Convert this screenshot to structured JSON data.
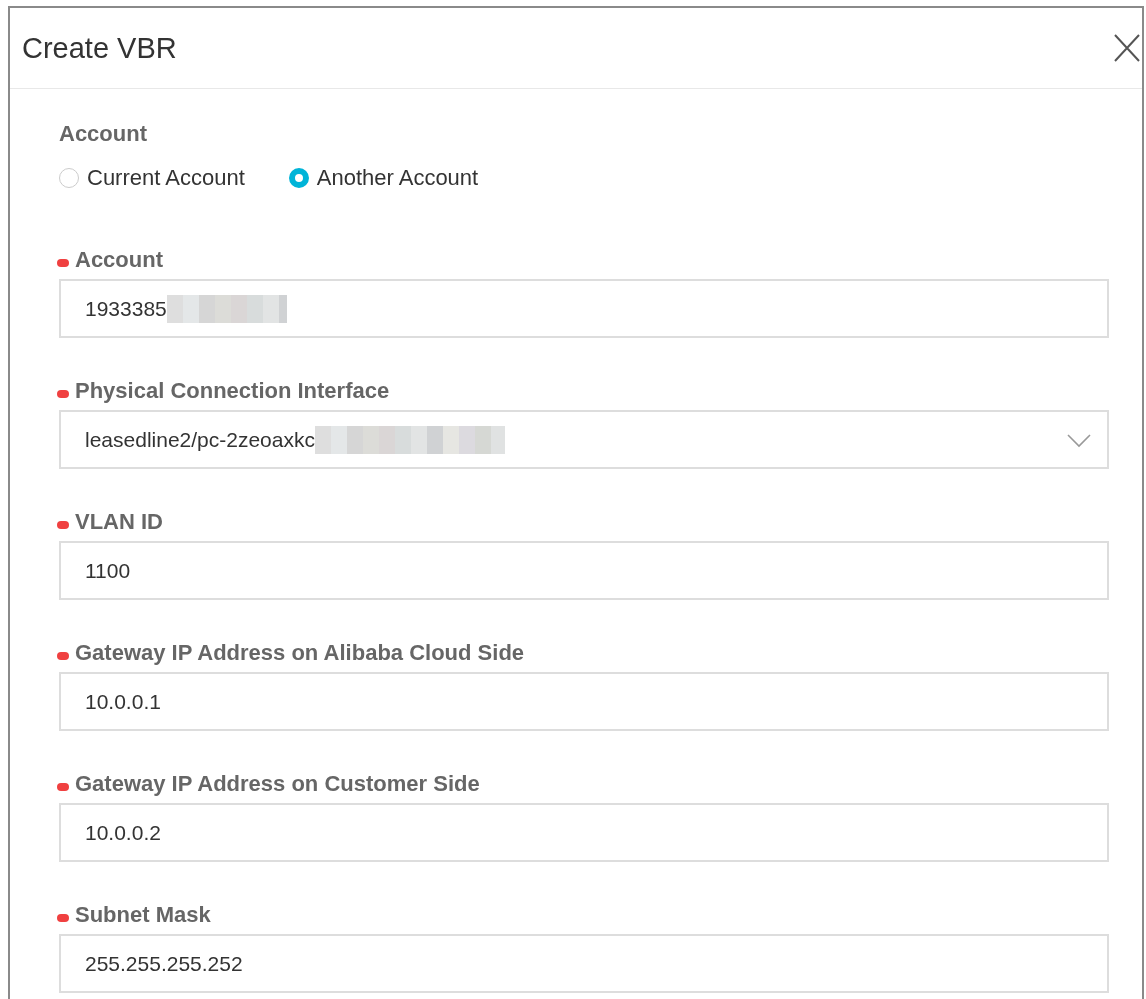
{
  "dialog": {
    "title": "Create VBR"
  },
  "account_type": {
    "label": "Account",
    "options": [
      {
        "label": "Current Account",
        "selected": false
      },
      {
        "label": "Another Account",
        "selected": true
      }
    ]
  },
  "fields": [
    {
      "label": "Account",
      "required": true,
      "kind": "text",
      "value": "1933385",
      "redacted": true
    },
    {
      "label": "Physical Connection Interface",
      "required": true,
      "kind": "select",
      "value": "leasedline2/pc-2zeoaxkc",
      "redacted": true
    },
    {
      "label": "VLAN ID",
      "required": true,
      "kind": "text",
      "value": "1100",
      "redacted": false
    },
    {
      "label": "Gateway IP Address on Alibaba Cloud Side",
      "required": true,
      "kind": "text",
      "value": "10.0.0.1",
      "redacted": false
    },
    {
      "label": "Gateway IP Address on Customer Side",
      "required": true,
      "kind": "text",
      "value": "10.0.0.2",
      "redacted": false
    },
    {
      "label": "Subnet Mask",
      "required": true,
      "kind": "text",
      "value": "255.255.255.252",
      "redacted": false
    }
  ]
}
